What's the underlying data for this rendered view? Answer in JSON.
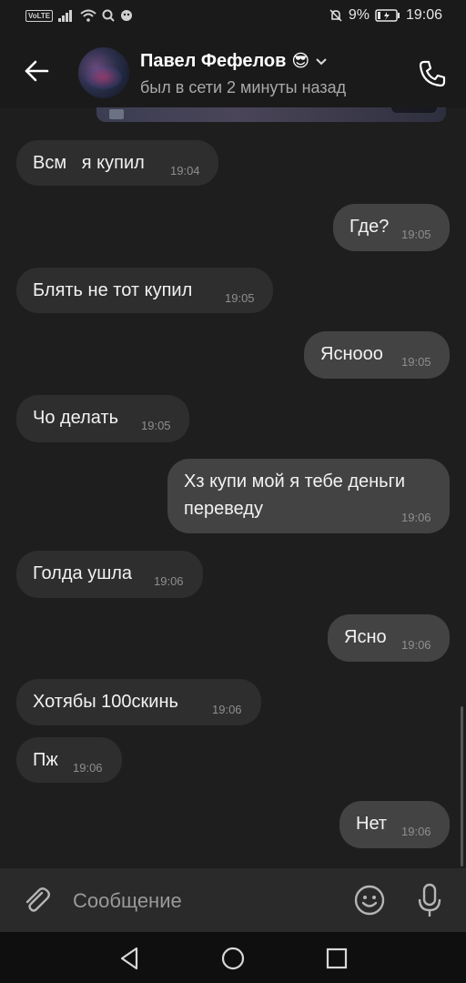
{
  "status_bar": {
    "left_badge": "VoLTE",
    "battery_percent": "9%",
    "time": "19:06",
    "icons": [
      "volte-icon",
      "signal-icon",
      "wifi-icon",
      "search-icon",
      "notification-icon",
      "mute-icon",
      "battery-icon"
    ]
  },
  "header": {
    "contact_name": "Павел Фефелов",
    "emoji": "😎",
    "presence": "был в сети 2 минуты назад",
    "icons": [
      "back-arrow-icon",
      "chevron-down-icon",
      "phone-icon"
    ]
  },
  "messages": [
    {
      "direction": "in",
      "text": "Всм   я купил",
      "time": "19:04"
    },
    {
      "direction": "out",
      "text": "Где?",
      "time": "19:05"
    },
    {
      "direction": "in",
      "text": "Блять не тот купил",
      "time": "19:05"
    },
    {
      "direction": "out",
      "text": "Яснооо",
      "time": "19:05"
    },
    {
      "direction": "in",
      "text": "Чо делать",
      "time": "19:05"
    },
    {
      "direction": "out",
      "text": "Хз купи мой я тебе деньги\nпереведу",
      "time": "19:06"
    },
    {
      "direction": "in",
      "text": "Голда ушла",
      "time": "19:06"
    },
    {
      "direction": "out",
      "text": "Ясно",
      "time": "19:06"
    },
    {
      "direction": "in",
      "text": "Хотябы 100скинь",
      "time": "19:06"
    },
    {
      "direction": "in",
      "text": "Пж",
      "time": "19:06"
    },
    {
      "direction": "out",
      "text": "Нет",
      "time": "19:06"
    }
  ],
  "composer": {
    "placeholder": "Сообщение",
    "icons": [
      "attach-clip-icon",
      "emoji-smile-icon",
      "microphone-icon"
    ]
  },
  "nav_bar": {
    "icons": [
      "nav-back-icon",
      "nav-home-icon",
      "nav-recents-icon"
    ]
  },
  "colors": {
    "background": "#1e1e1e",
    "incoming_bubble": "#2e2e2e",
    "outgoing_bubble": "#434343",
    "text": "#f2f2f2",
    "timestamp": "#8e8e8e",
    "presence": "#a9a9a9"
  }
}
